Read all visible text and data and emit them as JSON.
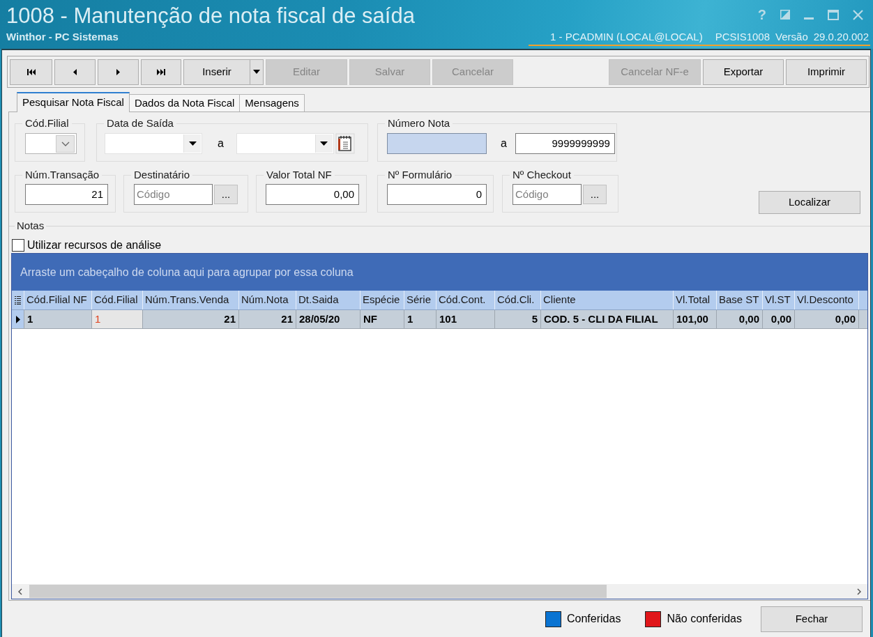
{
  "window": {
    "title": "1008 - Manutenção de nota fiscal de saída",
    "subtitle": "Winthor - PC Sistemas",
    "help": "?",
    "session": [
      "1 - PCADMIN (LOCAL@LOCAL)",
      "PCSIS1008",
      "Versão",
      "29.0.20.002"
    ]
  },
  "toolbar": {
    "left": [
      {
        "kind": "first",
        "disabled": false
      },
      {
        "kind": "previous",
        "disabled": false
      },
      {
        "kind": "next",
        "disabled": false
      },
      {
        "kind": "last",
        "disabled": false
      },
      {
        "kind": "split",
        "label": "Inserir",
        "disabled": false
      },
      {
        "kind": "text",
        "label": "Editar",
        "disabled": true
      },
      {
        "kind": "text",
        "label": "Salvar",
        "disabled": true
      },
      {
        "kind": "text",
        "label": "Cancelar",
        "disabled": true
      }
    ],
    "right": [
      {
        "kind": "text",
        "label": "Cancelar NF-e",
        "disabled": true
      },
      {
        "kind": "text",
        "label": "Exportar",
        "disabled": false
      },
      {
        "kind": "text",
        "label": "Imprimir",
        "disabled": false
      }
    ]
  },
  "tabs": [
    {
      "label": "Pesquisar Nota Fiscal",
      "selected": true
    },
    {
      "label": "Dados da Nota Fiscal",
      "selected": false
    },
    {
      "label": "Mensagens",
      "selected": false
    }
  ],
  "filters": {
    "row_1": [
      {
        "kind": "combo",
        "label": "Cód.Filial"
      },
      {
        "kind": "date_range",
        "label": "Data de Saída",
        "separator": "a"
      },
      {
        "kind": "range",
        "label": "Número Nota",
        "separator": "a",
        "to": "9999999999",
        "from_focused": true
      }
    ],
    "row_2": [
      {
        "kind": "text",
        "label": "Núm.Transação",
        "value": "21"
      },
      {
        "kind": "lookup",
        "label": "Destinatário",
        "placeholder": "Código",
        "button": "..."
      },
      {
        "kind": "text",
        "label": "Valor Total NF",
        "value": "0,00"
      },
      {
        "kind": "text",
        "label": "Nº Formulário",
        "value": "0"
      },
      {
        "kind": "lookup",
        "label": "Nº Checkout",
        "placeholder": "Código",
        "button": "..."
      }
    ],
    "search_button": "Localizar"
  },
  "notes": {
    "label": "Notas",
    "checkbox": {
      "label": "Utilizar recursos de análise",
      "checked": false
    }
  },
  "grid": {
    "group_hint": "Arraste um cabeçalho de coluna aqui para agrupar por essa coluna",
    "columns": [
      "Cód.Filial NF",
      "Cód.Filial",
      "Núm.Trans.Venda",
      "Núm.Nota",
      "Dt.Saida",
      "Espécie",
      "Série",
      "Cód.Cont.",
      "Cód.Cli.",
      "Cliente",
      "Vl.Total",
      "Base ST",
      "Vl.ST",
      "Vl.Desconto"
    ],
    "rows": [
      {
        "selected": true,
        "cells": [
          {
            "text": "1",
            "focused": false
          },
          {
            "text": "1",
            "focused": true
          },
          {
            "text": "21",
            "focused": false
          },
          {
            "text": "21",
            "focused": false
          },
          {
            "text": "28/05/20",
            "focused": false
          },
          {
            "text": "NF",
            "focused": false
          },
          {
            "text": "1",
            "focused": false
          },
          {
            "text": "101",
            "focused": false
          },
          {
            "text": "5",
            "focused": false
          },
          {
            "text": "COD. 5 - CLI DA FILIAL",
            "focused": false
          },
          {
            "text": "101,00",
            "focused": false
          },
          {
            "text": "0,00",
            "focused": false
          },
          {
            "text": "0,00",
            "focused": false
          },
          {
            "text": "0,00",
            "focused": false
          }
        ]
      }
    ]
  },
  "footer": {
    "legend": [
      {
        "label": "Conferidas",
        "color": "#0a74d2"
      },
      {
        "label": "Não conferidas",
        "color": "#e0161a"
      }
    ],
    "close_button": "Fechar"
  }
}
